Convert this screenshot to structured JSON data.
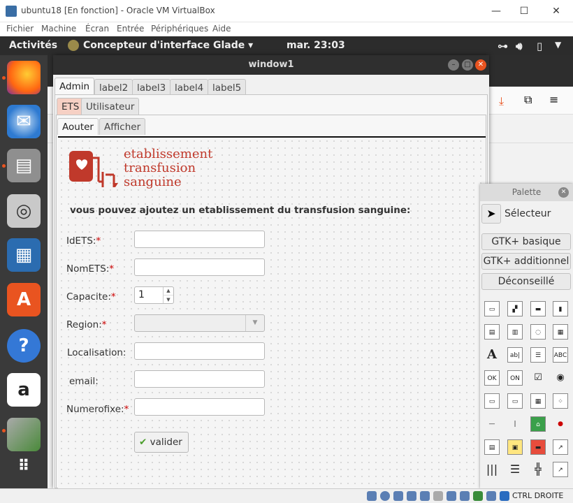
{
  "host": {
    "title": "ubuntu18 [En fonction] - Oracle VM VirtualBox",
    "menu": [
      "Fichier",
      "Machine",
      "Écran",
      "Entrée",
      "Périphériques",
      "Aide"
    ]
  },
  "topbar": {
    "activities": "Activités",
    "app_menu": "Concepteur d'interface Glade ▾",
    "clock": "mar. 23:03"
  },
  "window": {
    "title": "window1",
    "tabs_level1": [
      "Admin",
      "label2",
      "label3",
      "label4",
      "label5"
    ],
    "tabs_level2": [
      "ETS",
      "Utilisateur"
    ],
    "tabs_level3": [
      "Aouter",
      "Afficher"
    ]
  },
  "logo": {
    "line1": "etablissement",
    "line2": "transfusion",
    "line3": "sanguine",
    "color": "#c0392b"
  },
  "form": {
    "heading": "vous pouvez ajoutez un etablissement du transfusion sanguine:",
    "fields": {
      "idets": {
        "label": "IdETS:",
        "req": "*"
      },
      "nomets": {
        "label": "NomETS:",
        "req": "*"
      },
      "capacite": {
        "label": "Capacite:",
        "req": "*",
        "value": "1"
      },
      "region": {
        "label": "Region:",
        "req": "*"
      },
      "localisation": {
        "label": "Localisation:"
      },
      "email": {
        "label": "email:"
      },
      "numerofixe": {
        "label": "Numerofixe:",
        "req": "*"
      }
    },
    "submit": "valider"
  },
  "palette": {
    "title": "Palette",
    "selector": "Sélecteur",
    "groups": [
      "GTK+ basique",
      "GTK+ additionnel",
      "Déconseillé"
    ],
    "tools": [
      "ABC",
      "ab|",
      "OK",
      "ON",
      "☑",
      "◉"
    ]
  },
  "statusbar": {
    "host_key": "CTRL DROITE"
  }
}
